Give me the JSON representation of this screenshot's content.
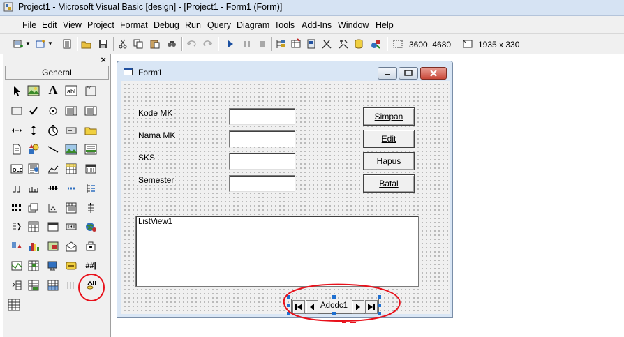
{
  "window": {
    "title": "Project1 - Microsoft Visual Basic [design] - [Project1 - Form1 (Form)]"
  },
  "menu": [
    "File",
    "Edit",
    "View",
    "Project",
    "Format",
    "Debug",
    "Run",
    "Query",
    "Diagram",
    "Tools",
    "Add-Ins",
    "Window",
    "Help"
  ],
  "toolbar": {
    "position": "3600, 4680",
    "size": "1935 x 330"
  },
  "toolbox": {
    "close": "×",
    "tab": "General"
  },
  "form": {
    "title": "Form1",
    "labels": {
      "kode": "Kode MK",
      "nama": "Nama MK",
      "sks": "SKS",
      "semester": "Semester"
    },
    "buttons": {
      "simpan": "Simpan",
      "edit": "Edit",
      "hapus": "Hapus",
      "batal": "Batal"
    },
    "listview": "ListView1",
    "adodc": "Adodc1"
  },
  "colors": {
    "annotation": "#e8111b",
    "selection_handle": "#1e6fd0"
  }
}
